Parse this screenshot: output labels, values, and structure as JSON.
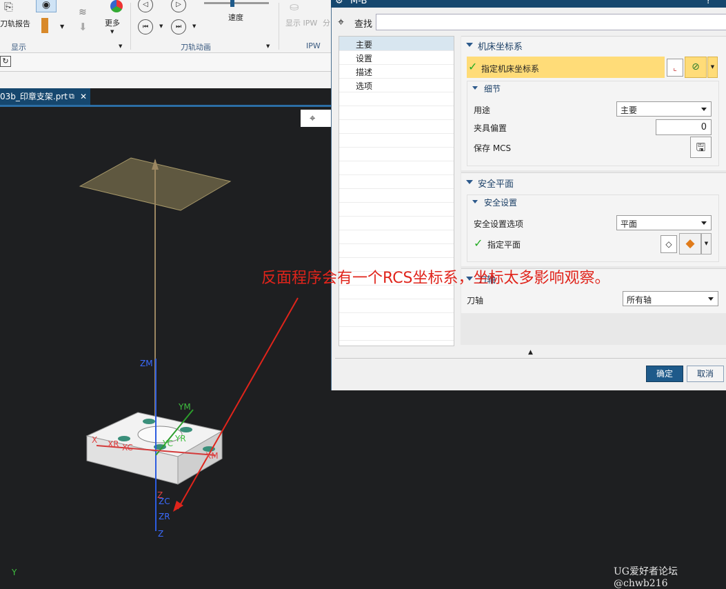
{
  "ribbon": {
    "tool_report": "刀轨报告",
    "more": "更多",
    "speed": "速度",
    "show_ipw": "显示 IPW",
    "split_fragment": "分",
    "group_display": "显示",
    "group_toolpath_anim": "刀轨动画",
    "group_ipw": "IPW"
  },
  "file_tab": {
    "name": "03b_印章支架.prt"
  },
  "dialog": {
    "title": "M-B",
    "find_label": "查找",
    "tree": [
      "主要",
      "设置",
      "描述",
      "选项"
    ],
    "section_mcs": "机床坐标系",
    "specify_mcs": "指定机床坐标系",
    "sub_details": "细节",
    "purpose_label": "用途",
    "purpose_value": "主要",
    "fixture_offset_label": "夹具偏置",
    "fixture_offset_value": "0",
    "save_mcs_label": "保存 MCS",
    "section_safe_plane": "安全平面",
    "sub_safe_settings": "安全设置",
    "safe_option_label": "安全设置选项",
    "safe_option_value": "平面",
    "specify_plane": "指定平面",
    "section_tool_axis": "刀轴",
    "tool_axis_label": "刀轴",
    "tool_axis_value": "所有轴",
    "ok": "确定",
    "cancel": "取消"
  },
  "viewport": {
    "axis_labels": [
      "ZM",
      "YM",
      "YR",
      "YC",
      "X",
      "XR",
      "XC",
      "XM",
      "Z",
      "ZC",
      "ZR",
      "Z",
      "Y"
    ]
  },
  "annotation": "反面程序会有一个RCS坐标系，坐标太多影响观察。",
  "watermark": "UG爱好者论坛@chwb216",
  "colors": {
    "title_bar": "#16476e",
    "highlight": "#ffdc78",
    "annotation": "#e0241b",
    "check": "#22aa22"
  }
}
